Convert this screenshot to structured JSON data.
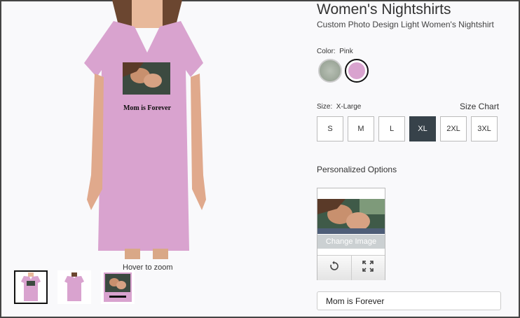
{
  "product": {
    "title": "Women's Nightshirts",
    "subtitle": "Custom Photo Design Light Women's Nightshirt",
    "shirt_text": "Mom is Forever",
    "hover_hint": "Hover to zoom"
  },
  "color": {
    "label": "Color:",
    "selected": "Pink",
    "options": [
      {
        "name": "gray",
        "hex": "#a0aa9d"
      },
      {
        "name": "pink",
        "hex": "#d9a3cf"
      }
    ]
  },
  "size": {
    "label": "Size:",
    "selected": "X-Large",
    "chart_link": "Size Chart",
    "options": [
      "S",
      "M",
      "L",
      "XL",
      "2XL",
      "3XL"
    ],
    "active": "XL"
  },
  "personalized": {
    "label": "Personalized Options",
    "change_image": "Change Image",
    "text_value": "Mom is Forever"
  },
  "icons": [
    "rotate-icon",
    "fullscreen-icon"
  ],
  "colors": {
    "accent": "#37424a",
    "pink": "#d9a3cf"
  }
}
